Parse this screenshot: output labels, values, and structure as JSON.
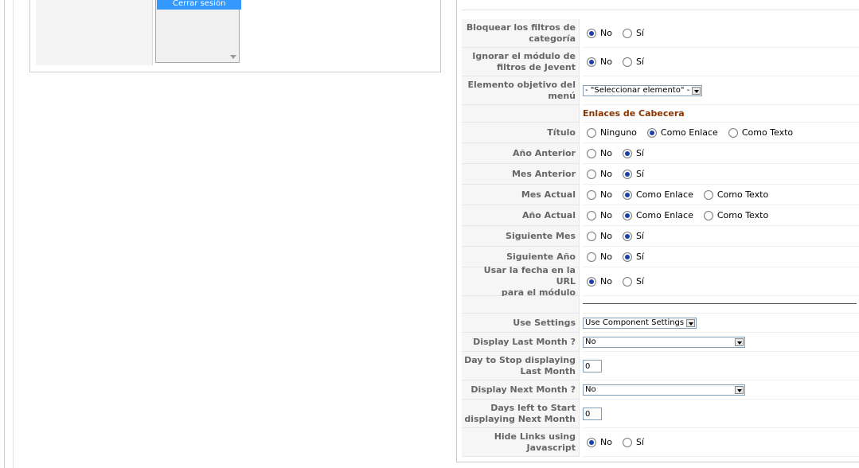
{
  "left_menu": {
    "selected_item": "Cerrar sesión"
  },
  "params": {
    "lock_filters": {
      "label_1": "Bloquear los filtros de",
      "label_2": "categoría",
      "options": [
        "No",
        "Sí"
      ]
    },
    "ignore_filters": {
      "label_1": "Ignorar el módulo de",
      "label_2": "filtros de Jevent",
      "options": [
        "No",
        "Sí"
      ]
    },
    "menu_target": {
      "label_1": "Elemento objetivo del",
      "label_2": "menú",
      "value": "- \"Seleccionar elemento\" -"
    },
    "section_header": "Enlaces de Cabecera",
    "title": {
      "label": "Título",
      "options": [
        "Ninguno",
        "Como Enlace",
        "Como Texto"
      ]
    },
    "prev_year": {
      "label": "Año Anterior",
      "options": [
        "No",
        "Sí"
      ]
    },
    "prev_month": {
      "label": "Mes Anterior",
      "options": [
        "No",
        "Sí"
      ]
    },
    "cur_month": {
      "label": "Mes Actual",
      "options": [
        "No",
        "Como Enlace",
        "Como Texto"
      ]
    },
    "cur_year": {
      "label": "Año Actual",
      "options": [
        "No",
        "Como Enlace",
        "Como Texto"
      ]
    },
    "next_month": {
      "label": "Siguiente Mes",
      "options": [
        "No",
        "Sí"
      ]
    },
    "next_year": {
      "label": "Siguiente Año",
      "options": [
        "No",
        "Sí"
      ]
    },
    "url_date": {
      "label_1": "Usar la fecha en la URL",
      "label_2": "para el módulo",
      "options": [
        "No",
        "Sí"
      ]
    },
    "use_settings": {
      "label": "Use Settings",
      "value": "Use Component Settings"
    },
    "display_last_month": {
      "label": "Display Last Month ?",
      "value": "No"
    },
    "day_stop_last": {
      "label_1": "Day to Stop displaying",
      "label_2": "Last Month",
      "value": "0"
    },
    "display_next_month": {
      "label": "Display Next Month ?",
      "value": "No"
    },
    "days_left_next": {
      "label_1": "Days left to Start",
      "label_2": "displaying Next Month",
      "value": "0"
    },
    "hide_links": {
      "label_1": "Hide Links using",
      "label_2": "Javascript",
      "options": [
        "No",
        "Sí"
      ]
    }
  }
}
